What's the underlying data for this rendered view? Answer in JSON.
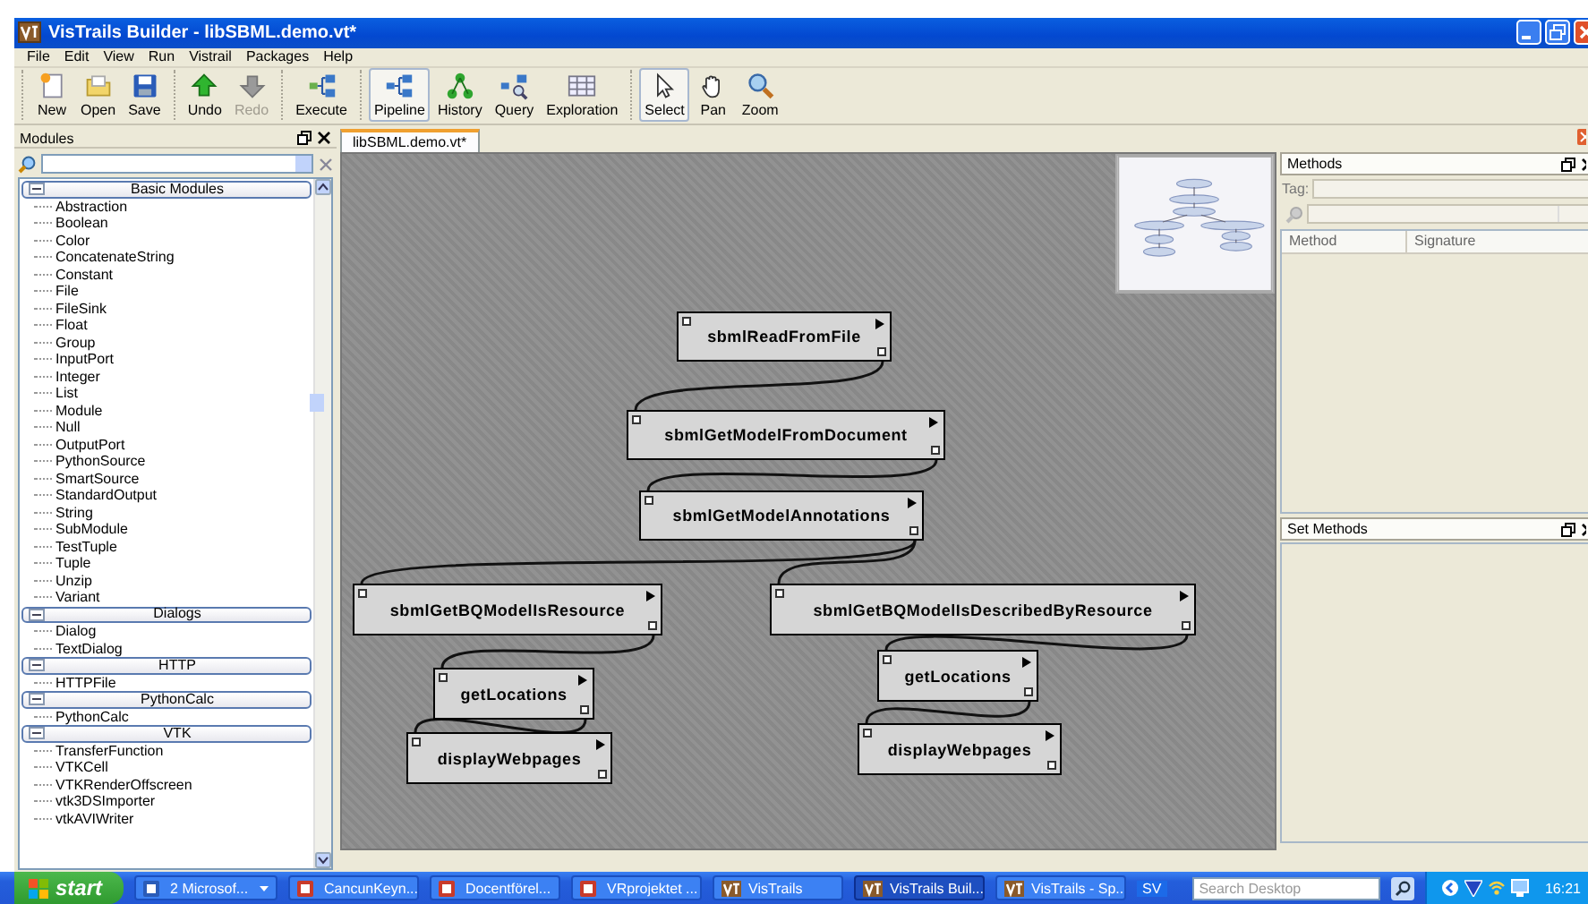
{
  "window": {
    "title": "VisTrails Builder - libSBML.demo.vt*"
  },
  "menu": [
    "File",
    "Edit",
    "View",
    "Run",
    "Vistrail",
    "Packages",
    "Help"
  ],
  "toolbar_groups": [
    {
      "buttons": [
        {
          "label": "New",
          "kind": "new",
          "disabled": false
        },
        {
          "label": "Open",
          "kind": "open",
          "disabled": false
        },
        {
          "label": "Save",
          "kind": "save",
          "disabled": false
        }
      ]
    },
    {
      "buttons": [
        {
          "label": "Undo",
          "kind": "undo",
          "disabled": false
        },
        {
          "label": "Redo",
          "kind": "redo",
          "disabled": true
        }
      ]
    },
    {
      "buttons": [
        {
          "label": "Execute",
          "kind": "execute",
          "disabled": false
        }
      ]
    },
    {
      "buttons": [
        {
          "label": "Pipeline",
          "kind": "pipeline",
          "disabled": false,
          "selected": true
        },
        {
          "label": "History",
          "kind": "history",
          "disabled": false,
          "selected": false
        },
        {
          "label": "Query",
          "kind": "query",
          "disabled": false,
          "selected": false
        },
        {
          "label": "Exploration",
          "kind": "exploration",
          "disabled": false,
          "selected": false
        }
      ]
    },
    {
      "buttons": [
        {
          "label": "Select",
          "kind": "select",
          "disabled": false,
          "selected": true
        },
        {
          "label": "Pan",
          "kind": "pan",
          "disabled": false,
          "selected": false
        },
        {
          "label": "Zoom",
          "kind": "zoom",
          "disabled": false,
          "selected": false
        }
      ]
    }
  ],
  "modules_panel": {
    "title": "Modules",
    "tree": [
      {
        "label": "Basic Modules",
        "expanded": true,
        "children": [
          {
            "label": "Abstraction"
          },
          {
            "label": "Boolean"
          },
          {
            "label": "Color"
          },
          {
            "label": "ConcatenateString"
          },
          {
            "label": "Constant"
          },
          {
            "label": "File"
          },
          {
            "label": "FileSink"
          },
          {
            "label": "Float"
          },
          {
            "label": "Group"
          },
          {
            "label": "InputPort"
          },
          {
            "label": "Integer"
          },
          {
            "label": "List"
          },
          {
            "label": "Module"
          },
          {
            "label": "Null"
          },
          {
            "label": "OutputPort"
          },
          {
            "label": "PythonSource"
          },
          {
            "label": "SmartSource"
          },
          {
            "label": "StandardOutput"
          },
          {
            "label": "String"
          },
          {
            "label": "SubModule"
          },
          {
            "label": "TestTuple"
          },
          {
            "label": "Tuple"
          },
          {
            "label": "Unzip"
          },
          {
            "label": "Variant"
          }
        ]
      },
      {
        "label": "Dialogs",
        "expanded": true,
        "children": [
          {
            "label": "Dialog"
          },
          {
            "label": "TextDialog"
          }
        ]
      },
      {
        "label": "HTTP",
        "expanded": true,
        "children": [
          {
            "label": "HTTPFile"
          }
        ]
      },
      {
        "label": "PythonCalc",
        "expanded": true,
        "children": [
          {
            "label": "PythonCalc"
          }
        ]
      },
      {
        "label": "VTK",
        "expanded": true,
        "children": [
          {
            "label": "TransferFunction"
          },
          {
            "label": "VTKCell"
          },
          {
            "label": "VTKRenderOffscreen"
          },
          {
            "label": "vtk3DSImporter"
          },
          {
            "label": "vtkAVIWriter"
          }
        ]
      }
    ]
  },
  "document_tab": "libSBML.demo.vt*",
  "pipeline": [
    {
      "label": "sbmlReadFromFile",
      "children": [
        {
          "label": "sbmlGetModelFromDocument",
          "children": [
            {
              "label": "sbmlGetModelAnnotations",
              "children": [
                {
                  "label": "sbmlGetBQModelIsResource",
                  "children": [
                    {
                      "label": "getLocations",
                      "children": [
                        {
                          "label": "displayWebpages"
                        }
                      ]
                    }
                  ]
                },
                {
                  "label": "sbmlGetBQModelIsDescribedByResource",
                  "children": [
                    {
                      "label": "getLocations",
                      "children": [
                        {
                          "label": "displayWebpages"
                        }
                      ]
                    }
                  ]
                }
              ]
            }
          ]
        }
      ]
    }
  ],
  "methods_panel": {
    "title": "Methods",
    "tag_label": "Tag:",
    "columns": [
      "Method",
      "Signature"
    ]
  },
  "set_methods_panel": {
    "title": "Set Methods"
  },
  "taskbar": {
    "start": "start",
    "items": [
      {
        "label": "2 Microsof...",
        "kind": "word",
        "selected": false,
        "grouped": true
      },
      {
        "label": "CancunKeyn...",
        "kind": "powerpoint",
        "selected": false,
        "grouped": false
      },
      {
        "label": "Docentförel...",
        "kind": "powerpoint",
        "selected": false,
        "grouped": false
      },
      {
        "label": "VRprojektet ...",
        "kind": "powerpoint",
        "selected": false,
        "grouped": false
      },
      {
        "label": "VisTrails",
        "kind": "vistrails",
        "selected": false,
        "grouped": false
      },
      {
        "label": "VisTrails Buil...",
        "kind": "vistrails",
        "selected": true,
        "grouped": false
      },
      {
        "label": "VisTrails - Sp...",
        "kind": "vistrails",
        "selected": false,
        "grouped": false
      }
    ],
    "language": "SV",
    "search": {
      "placeholder": "Search Desktop"
    },
    "clock": "16:21"
  }
}
